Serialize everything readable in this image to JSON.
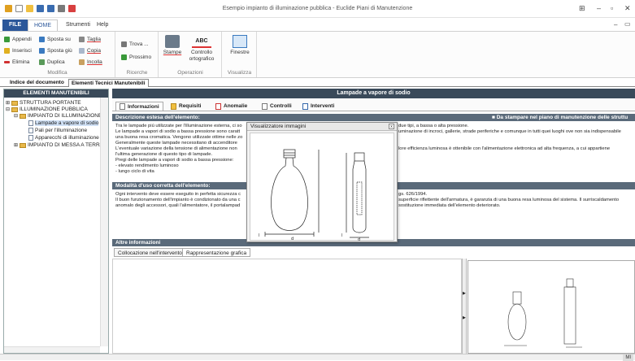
{
  "window": {
    "title": "Esempio impianto di illuminazione pubblica - Euclide Piani di Manutenzione"
  },
  "ribbon_tabs": [
    "FILE",
    "HOME",
    "Strumenti",
    "Help"
  ],
  "ribbon": {
    "modifica": {
      "label": "Modifica",
      "appendi": "Appendi",
      "inserisci": "Inserisci",
      "elimina": "Elimina",
      "sposta_su": "Sposta su",
      "sposta_giu": "Sposta giù",
      "duplica": "Duplica",
      "taglia": "Taglia",
      "copia": "Copia",
      "incolla": "Incolla"
    },
    "ricerche": {
      "label": "Ricerche",
      "trova": "Trova ...",
      "prossimo": "Prossimo"
    },
    "operazioni": {
      "label": "Operazioni",
      "stampe": "Stampe",
      "controllo": "Controllo ortografico"
    },
    "visualizza": {
      "label": "Visualizza",
      "finestre": "Finestre"
    }
  },
  "doc_tabs": [
    "Indice del documento",
    "Elementi Tecnici Manutenibili"
  ],
  "tree": {
    "header": "ELEMENTI MANUTENIBILI",
    "nodes": [
      {
        "label": "STRUTTURA PORTANTE"
      },
      {
        "label": "ILLUMINAZIONE PUBBLICA"
      },
      {
        "label": "IMPIANTO DI ILLUMINAZIONE"
      },
      {
        "label": "Lampade a vapore di sodio"
      },
      {
        "label": "Pali per l'illuminazione"
      },
      {
        "label": "Apparecchi di illuminazione"
      },
      {
        "label": "IMPIANTO DI MESSA A TERRA"
      }
    ]
  },
  "panel": {
    "title": "Lampade a vapore di sodio",
    "tabs": [
      "Informazioni",
      "Requisiti",
      "Anomalie",
      "Controlli",
      "Interventi"
    ],
    "desc_header": "Descrizione estesa dell'elemento:",
    "print_flag": "Da stampare nel piano di manutenzione delle struttu",
    "desc_left": "Tra le lampade più utilizzate per l'illuminazione esterna, ci so\nLe lampade a vapori di sodio a bassa pressione sono caratt\nuna buona resa cromatica. Vengono utilizzate ottime nelle zo\nGeneralmente queste lampade necessitano di accenditore\nL'eventuale variazione della tensione di alimentazione non\nl'ultima generazione di questo tipo di lampade.\nPregi delle lampade a vapori di sodio a bassa pressione:\n- elevato rendimento luminoso\n- lungo ciclo di vita",
    "desc_right": "due tipi, a bassa o alta pressione.\numinazione di incroci, gallerie, strade periferiche e comunque in tutti quei luoghi ove non sia indispensabile\n\n\nlore efficienza luminosa è ottenibile con l'alimentazione elettronica ad alta frequenza, a cui appartiene",
    "use_header": "Modalità d'uso corretta dell'elemento:",
    "use_left": "Ogni intervento deve essere eseguito in perfetta sicurezza c\nIl buon funzionamento dell'impianto è condizionato da una c\nanomalo degli accessori, quali l'alimentatore, il portalampad",
    "use_right": "gs. 626/1994.\nsuperficie riflettente dell'armatura, è garanzia di una buona resa luminosa del sistema. Il surriscaldamento\nsostituzione immediata dell'elemento deteriorato.",
    "other_header": "Altre informazioni",
    "other_tabs": [
      "Collocazione nell'intervento",
      "Rappresentazione grafica"
    ]
  },
  "modal": {
    "title": "Visualizzatore immagini",
    "close": "x",
    "labels": {
      "d": "d",
      "l": "l"
    }
  },
  "status": {
    "right": "MI"
  }
}
